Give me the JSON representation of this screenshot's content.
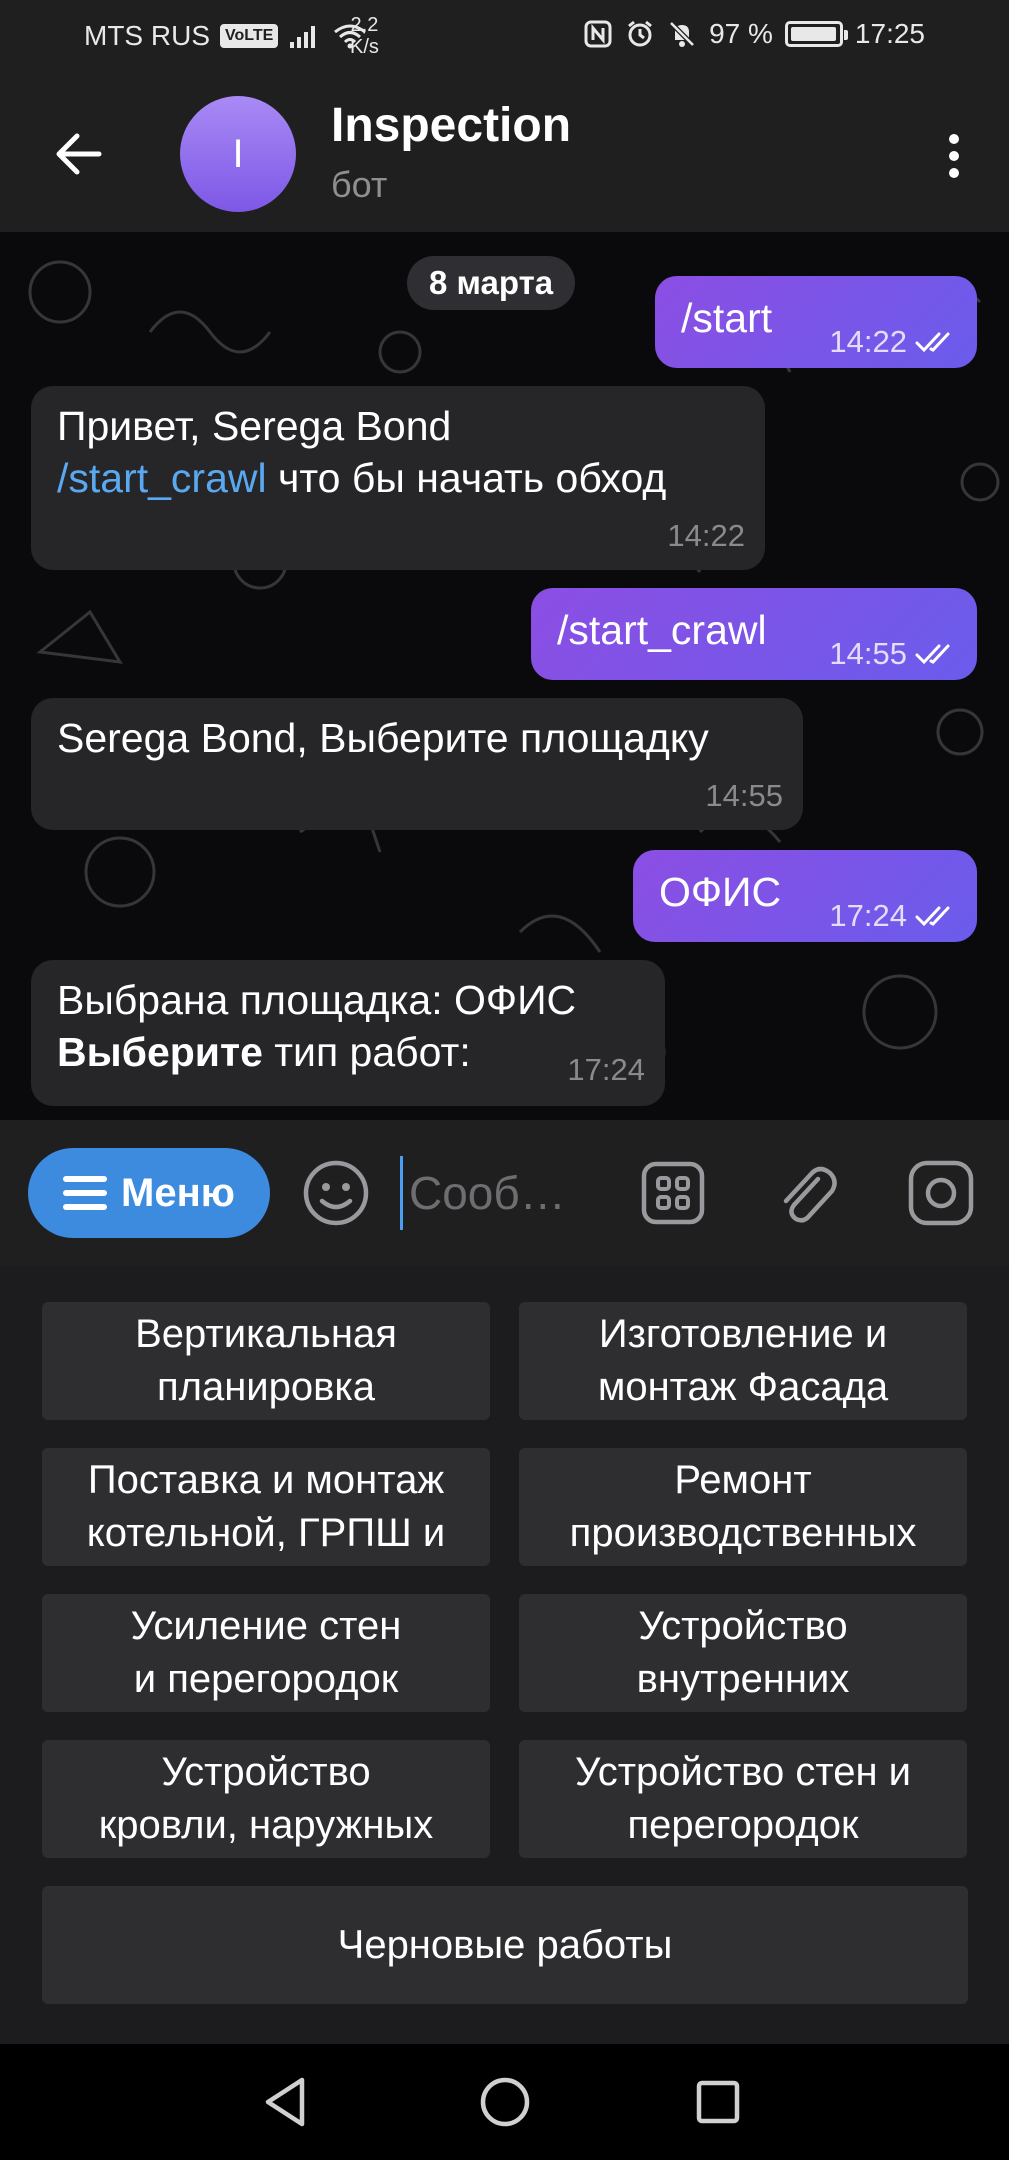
{
  "status_bar": {
    "carrier": "MTS RUS",
    "volte": "VoLTE",
    "speed_value": "2,2",
    "speed_unit": "K/s",
    "battery": "97 %",
    "battery_level": 0.97,
    "time": "17:25"
  },
  "header": {
    "avatar_letter": "I",
    "title": "Inspection",
    "subtitle": "бот"
  },
  "chat": {
    "date": "8 марта",
    "messages": [
      {
        "direction": "out",
        "text": "/start",
        "time": "14:22"
      },
      {
        "direction": "in",
        "line1": "Привет, Serega Bond",
        "link": "/start_crawl",
        "line2_rest": " что бы начать обход",
        "time": "14:22"
      },
      {
        "direction": "out",
        "text": "/start_crawl",
        "time": "14:55"
      },
      {
        "direction": "in",
        "text": "Serega Bond, Выберите площадку",
        "time": "14:55"
      },
      {
        "direction": "out",
        "text": "ОФИС",
        "time": "17:24"
      },
      {
        "direction": "in",
        "line1": "Выбрана площадка: ОФИС",
        "bold": "Выберите",
        "line2_rest": " тип работ:",
        "time": "17:24"
      }
    ]
  },
  "input": {
    "menu_label": "Меню",
    "placeholder": "Сооб…"
  },
  "keyboard": {
    "buttons": [
      "Вертикальная\nпланировка",
      "Изготовление и\nмонтаж Фасада",
      "Поставка и монтаж\nкотельной, ГРПШ и",
      "Ремонт\nпроизводственных",
      "Усиление стен\nи перегородок",
      "Устройство\nвнутренних",
      "Устройство\nкровли, наружных",
      "Устройство стен и\nперегородок",
      "Черновые работы"
    ]
  },
  "colors": {
    "accent_blue": "#3d8bdf",
    "outgoing_bubble": "#7a55e8",
    "incoming_bubble": "#262629",
    "link": "#5aa9f0"
  }
}
